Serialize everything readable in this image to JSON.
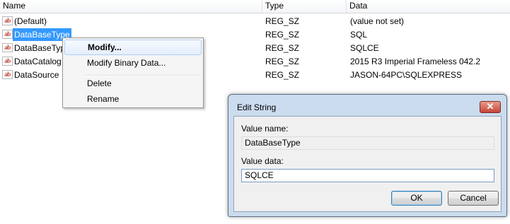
{
  "list": {
    "columns": [
      "Name",
      "Type",
      "Data"
    ],
    "rows": [
      {
        "name": "(Default)",
        "type": "REG_SZ",
        "data": "(value not set)"
      },
      {
        "name": "DataBaseType",
        "type": "REG_SZ",
        "data": "SQL"
      },
      {
        "name": "DataBaseTyp",
        "type": "REG_SZ",
        "data": "SQLCE"
      },
      {
        "name": "DataCatalog",
        "type": "REG_SZ",
        "data": "2015 R3 Imperial Frameless 042.2"
      },
      {
        "name": "DataSource",
        "type": "REG_SZ",
        "data": "JASON-64PC\\SQLEXPRESS"
      }
    ],
    "selected_index": 1,
    "icon": "string-value-icon"
  },
  "context_menu": {
    "items": [
      "Modify...",
      "Modify Binary Data...",
      "Delete",
      "Rename"
    ],
    "highlighted": "Modify..."
  },
  "dialog": {
    "title": "Edit String",
    "close_glyph": "✕",
    "value_name_label": "Value name:",
    "value_name": "DataBaseType",
    "value_data_label": "Value data:",
    "value_data": "SQLCE",
    "ok_label": "OK",
    "cancel_label": "Cancel"
  },
  "colors": {
    "selection": "#3399ff",
    "dialog_frame": "#cbdcef",
    "close_button": "#c5463a"
  }
}
